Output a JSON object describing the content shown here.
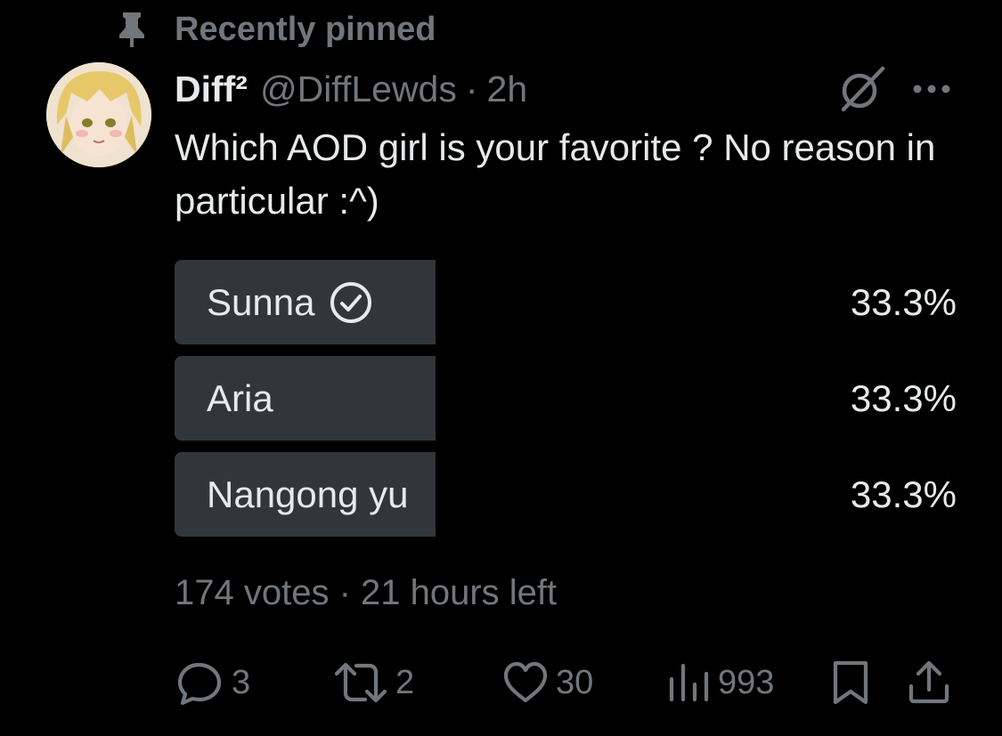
{
  "pinned": {
    "icon": "pin-icon",
    "label": "Recently pinned"
  },
  "author": {
    "display_name": "Diff²",
    "handle": "@DiffLewds",
    "separator": "·",
    "time": "2h",
    "avatar": "avatar-anime-girl"
  },
  "header_icons": [
    "grok-icon",
    "more-icon"
  ],
  "tweet": {
    "text": "Which AOD girl is your favorite ? No reason in particular :^)"
  },
  "poll": {
    "options": [
      {
        "label": "Sunna",
        "percent": "33.3%",
        "share": 0.333,
        "selected": true
      },
      {
        "label": "Aria",
        "percent": "33.3%",
        "share": 0.333,
        "selected": false
      },
      {
        "label": "Nangong yu",
        "percent": "33.3%",
        "share": 0.333,
        "selected": false
      }
    ],
    "footer": "174 votes · 21 hours left",
    "bar_color": "#333639"
  },
  "actions": {
    "reply": {
      "icon": "reply-icon",
      "count": "3"
    },
    "repost": {
      "icon": "repost-icon",
      "count": "2"
    },
    "like": {
      "icon": "heart-icon",
      "count": "30"
    },
    "views": {
      "icon": "views-icon",
      "count": "993"
    },
    "bookmark": {
      "icon": "bookmark-icon"
    },
    "share": {
      "icon": "share-icon"
    }
  },
  "colors": {
    "background": "#000000",
    "text": "#e7e9ea",
    "secondary": "#71767b"
  }
}
